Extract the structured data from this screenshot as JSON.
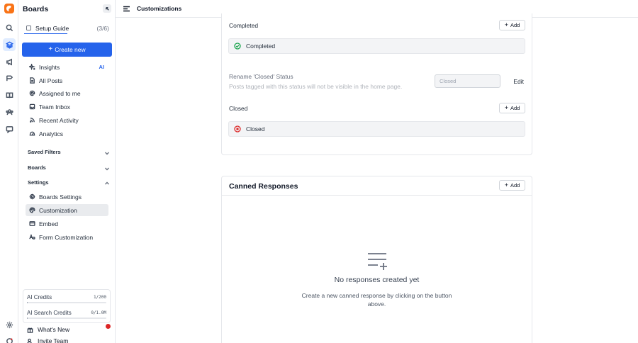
{
  "sidebar": {
    "title": "Boards",
    "setup": {
      "label": "Setup Guide",
      "count": "(3/6)"
    },
    "create_label": "Create new",
    "primary_items": [
      {
        "label": "Insights",
        "badge": "AI",
        "icon": "sparkle-icon"
      },
      {
        "label": "All Posts",
        "icon": "document-icon"
      },
      {
        "label": "Assigned to me",
        "icon": "at-icon"
      },
      {
        "label": "Team Inbox",
        "icon": "inbox-icon"
      },
      {
        "label": "Recent Activity",
        "icon": "rss-icon"
      },
      {
        "label": "Analytics",
        "icon": "gauge-icon"
      }
    ],
    "sections": {
      "saved_filters": "Saved Filters",
      "boards": "Boards",
      "settings": "Settings"
    },
    "settings_items": [
      {
        "label": "Boards Settings",
        "icon": "gear-icon"
      },
      {
        "label": "Customization",
        "icon": "palette-icon",
        "selected": true
      },
      {
        "label": "Embed",
        "icon": "embed-icon"
      },
      {
        "label": "Form Customization",
        "icon": "font-icon"
      }
    ],
    "credits": [
      {
        "name": "AI Credits",
        "value": "1/200",
        "fraction": 0.005
      },
      {
        "name": "AI Search Credits",
        "value": "0/1.0M",
        "fraction": 0
      }
    ],
    "whats_new": "What's New",
    "invite": "Invite Team"
  },
  "topbar": {
    "title": "Customizations"
  },
  "statuses": {
    "completed_heading": "Completed",
    "completed_item": "Completed",
    "rename_title": "Rename 'Closed' Status",
    "rename_desc": "Posts tagged with this status will not be visible in the home page.",
    "rename_value": "Closed",
    "edit_label": "Edit",
    "closed_heading": "Closed",
    "closed_item": "Closed",
    "add_label": "Add"
  },
  "canned": {
    "title": "Canned Responses",
    "add_label": "Add",
    "empty_title": "No responses created yet",
    "empty_desc": "Create a new canned response by clicking on the button above."
  },
  "colors": {
    "accent": "#2563eb",
    "brand": "#f97316",
    "success": "#16a34a",
    "danger": "#dc2626"
  }
}
